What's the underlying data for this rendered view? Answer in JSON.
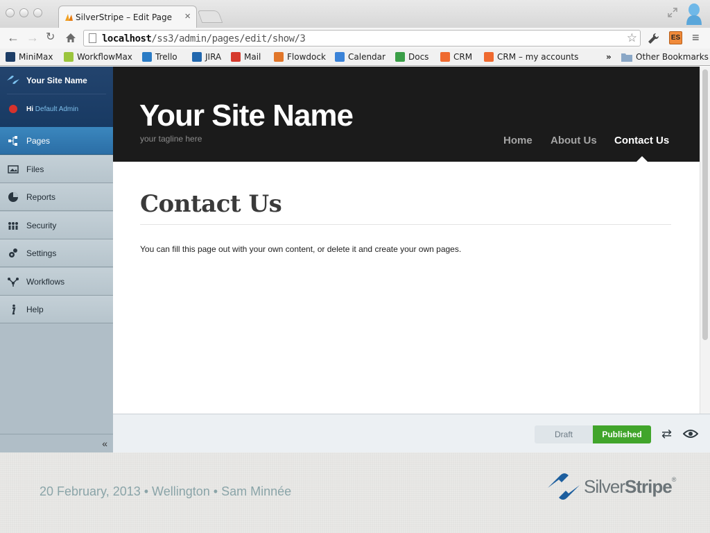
{
  "browser": {
    "tab_title": "SilverStripe – Edit Page",
    "tab_close": "×",
    "url_host": "localhost",
    "url_path": "/ss3/admin/pages/edit/show/3",
    "toolbar_ext_label": "ES",
    "bookmarks": [
      {
        "label": "MiniMax",
        "icon": "m-icon",
        "color": "#1d3d66"
      },
      {
        "label": "WorkflowMax",
        "icon": "wfm-icon",
        "color": "#9bc53d"
      },
      {
        "label": "Trello",
        "icon": "trello-icon",
        "color": "#2a7bc5"
      },
      {
        "label": "JIRA",
        "icon": "jira-icon",
        "color": "#2167ae"
      },
      {
        "label": "Mail",
        "icon": "gmail-icon",
        "color": "#d63a2d"
      },
      {
        "label": "Flowdock",
        "icon": "flowdock-icon",
        "color": "#e1762a"
      },
      {
        "label": "Calendar",
        "icon": "calendar-icon",
        "color": "#3b83d8"
      },
      {
        "label": "Docs",
        "icon": "drive-icon",
        "color": "#3a9e47"
      },
      {
        "label": "CRM",
        "icon": "crm-icon",
        "color": "#ef6a30"
      },
      {
        "label": "CRM – my accounts",
        "icon": "crm-icon",
        "color": "#ef6a30"
      }
    ],
    "bookmarks_more": "»",
    "other_bookmarks": "Other Bookmarks"
  },
  "cms": {
    "site_name": "Your Site Name",
    "user_greeting": "Hi",
    "user_name": "Default Admin",
    "menu": [
      {
        "label": "Pages",
        "icon": "sitetree-icon",
        "active": true
      },
      {
        "label": "Files",
        "icon": "image-icon",
        "active": false
      },
      {
        "label": "Reports",
        "icon": "pie-chart-icon",
        "active": false
      },
      {
        "label": "Security",
        "icon": "users-icon",
        "active": false
      },
      {
        "label": "Settings",
        "icon": "gears-icon",
        "active": false
      },
      {
        "label": "Workflows",
        "icon": "workflow-icon",
        "active": false
      },
      {
        "label": "Help",
        "icon": "info-icon",
        "active": false
      }
    ],
    "collapse_label": "«"
  },
  "preview": {
    "site_title": "Your Site Name",
    "tagline": "your tagline here",
    "nav": [
      "Home",
      "About Us",
      "Contact Us"
    ],
    "current_nav": "Contact Us",
    "page_heading": "Contact Us",
    "page_body": "You can fill this page out with your own content, or delete it and create your own pages."
  },
  "actions": {
    "draft_label": "Draft",
    "published_label": "Published",
    "state": "Published"
  },
  "footer": {
    "text": "20 February, 2013 • Wellington • Sam Minnée",
    "logo_word_1": "Silver",
    "logo_word_2": "Stripe",
    "logo_reg": "®"
  },
  "colors": {
    "cms_header": "#183a63",
    "active_menu": "#2b6ea6",
    "published_green": "#41a52b"
  }
}
